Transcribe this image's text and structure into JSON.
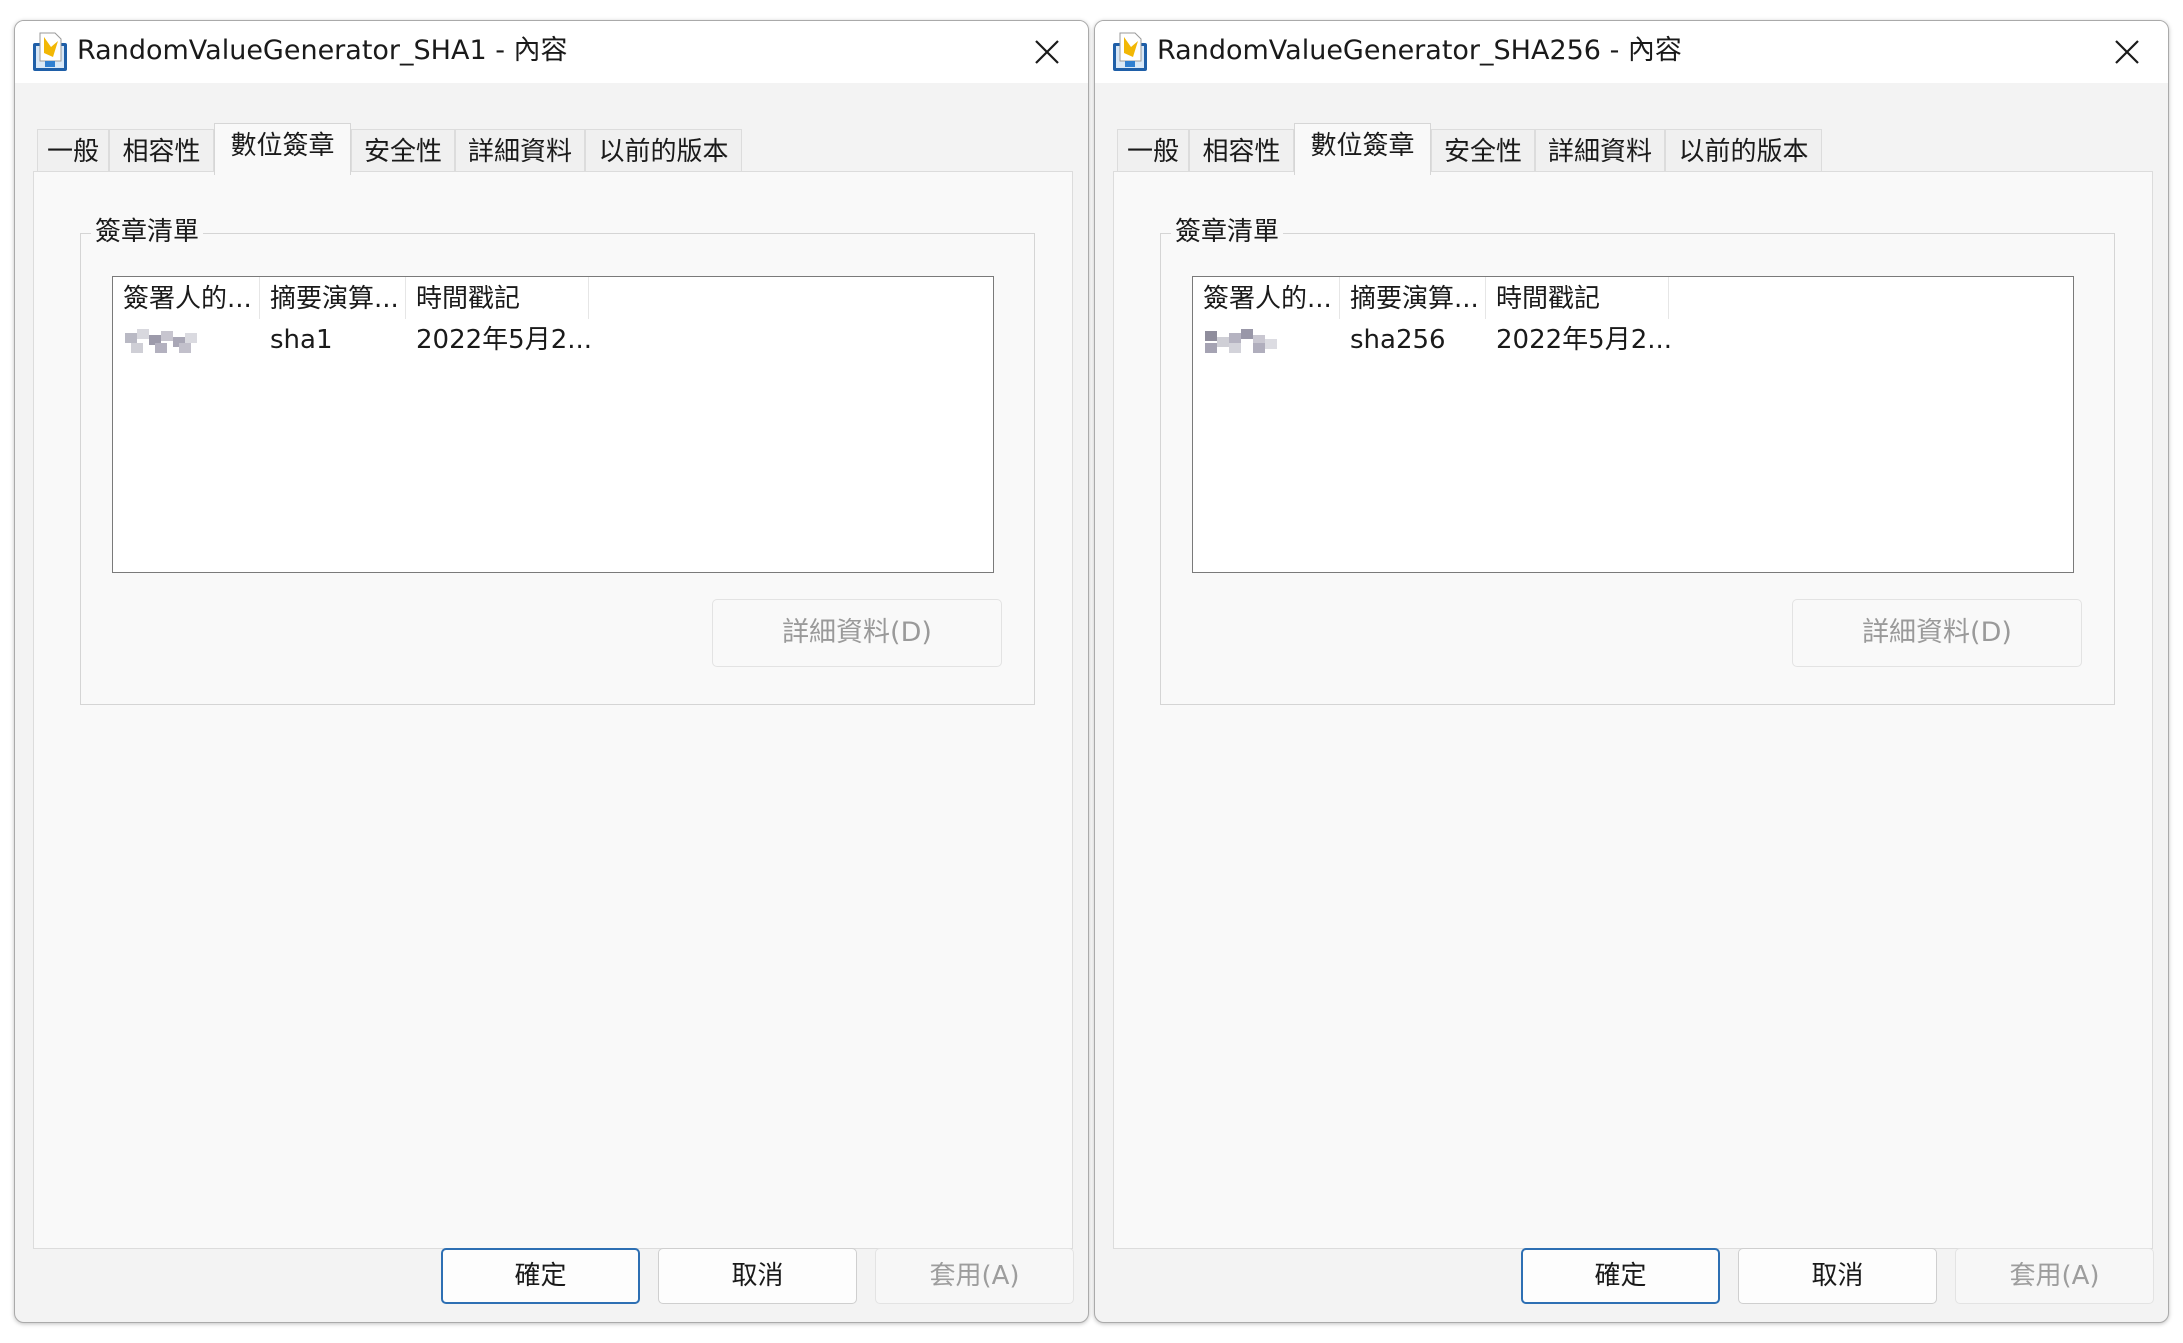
{
  "left": {
    "title": "RandomValueGenerator_SHA1 - 內容",
    "tabs": [
      "一般",
      "相容性",
      "數位簽章",
      "安全性",
      "詳細資料",
      "以前的版本"
    ],
    "active_tab": "數位簽章",
    "group_label": "簽章清單",
    "columns": [
      "簽署人的...",
      "摘要演算...",
      "時間戳記"
    ],
    "row": {
      "signer": "",
      "digest": "sha1",
      "timestamp": "2022年5月2..."
    },
    "details_button": "詳細資料(D)",
    "ok": "確定",
    "cancel": "取消",
    "apply": "套用(A)"
  },
  "right": {
    "title": "RandomValueGenerator_SHA256 - 內容",
    "tabs": [
      "一般",
      "相容性",
      "數位簽章",
      "安全性",
      "詳細資料",
      "以前的版本"
    ],
    "active_tab": "數位簽章",
    "group_label": "簽章清單",
    "columns": [
      "簽署人的...",
      "摘要演算...",
      "時間戳記"
    ],
    "row": {
      "signer": "",
      "digest": "sha256",
      "timestamp": "2022年5月2..."
    },
    "details_button": "詳細資料(D)",
    "ok": "確定",
    "cancel": "取消",
    "apply": "套用(A)"
  },
  "icons": {
    "app": "setup-package-icon",
    "close": "close-icon"
  },
  "colors": {
    "dialog_bg": "#f3f3f3",
    "panel_bg": "#f9f9f9",
    "default_button_border": "#2d6fb3",
    "disabled_text": "#9a9a9a"
  }
}
